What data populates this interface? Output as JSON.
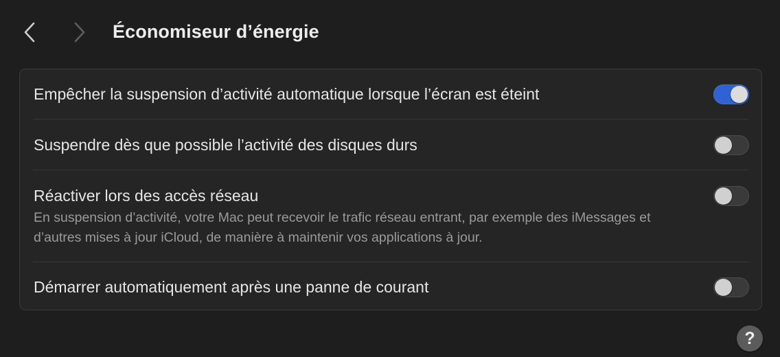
{
  "header": {
    "title": "Économiseur d’énergie",
    "back_icon": "chevron-left-icon",
    "forward_icon": "chevron-right-icon"
  },
  "settings": [
    {
      "label": "Empêcher la suspension d’activité automatique lorsque l’écran est éteint",
      "description": "",
      "enabled": true
    },
    {
      "label": "Suspendre dès que possible l’activité des disques durs",
      "description": "",
      "enabled": false
    },
    {
      "label": "Réactiver lors des accès réseau",
      "description": "En suspension d’activité, votre Mac peut recevoir le trafic réseau entrant, par exemple des iMessages et d’autres mises à jour iCloud, de manière à maintenir vos applications à jour.",
      "enabled": false
    },
    {
      "label": "Démarrer automatiquement après une panne de courant",
      "description": "",
      "enabled": false
    }
  ],
  "help": {
    "label": "?",
    "icon": "help-icon"
  },
  "colors": {
    "background": "#1e1e1e",
    "accent": "#2f63d4",
    "group_background": "#252525"
  }
}
